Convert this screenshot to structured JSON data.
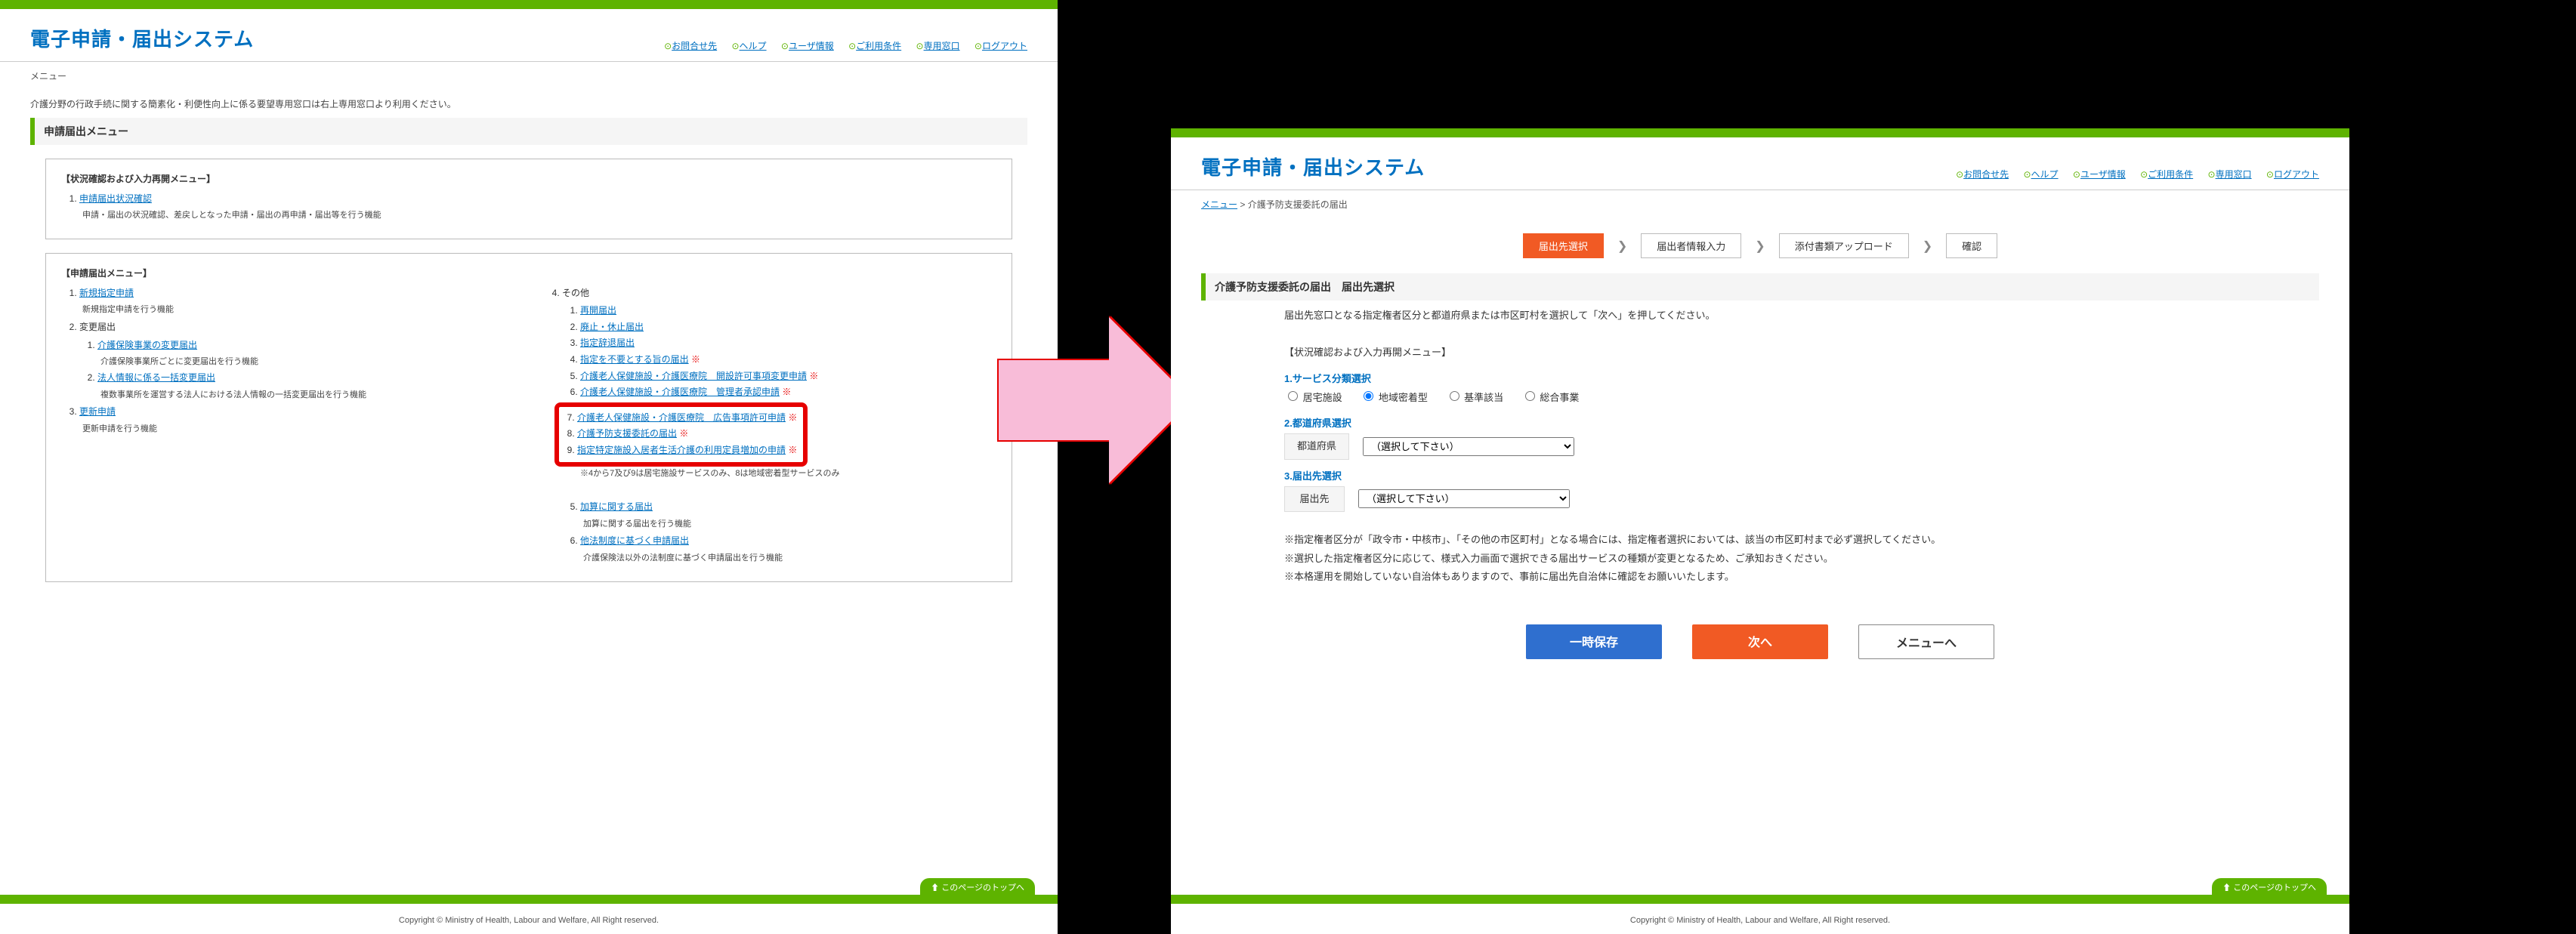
{
  "left": {
    "app_title": "電子申請・届出システム",
    "header_links": [
      "お問合せ先",
      "ヘルプ",
      "ユーザ情報",
      "ご利用条件",
      "専用窓口",
      "ログアウト"
    ],
    "breadcrumb": "メニュー",
    "notice": "介護分野の行政手続に関する簡素化・利便性向上に係る要望専用窓口は右上専用窓口より利用ください。",
    "section_title": "申請届出メニュー",
    "status_box": {
      "heading": "【状況確認および入力再開メニュー】",
      "link": "申請届出状況確認",
      "desc": "申請・届出の状況確認、差戻しとなった申請・届出の再申請・届出等を行う機能"
    },
    "menu_box": {
      "heading": "【申請届出メニュー】",
      "col_left": {
        "item1": {
          "link": "新規指定申請",
          "desc": "新規指定申請を行う機能"
        },
        "item2": {
          "label": "変更届出",
          "sub1": {
            "link": "介護保険事業の変更届出",
            "desc": "介護保険事業所ごとに変更届出を行う機能"
          },
          "sub2": {
            "link": "法人情報に係る一括変更届出",
            "desc": "複数事業所を運営する法人における法人情報の一括変更届出を行う機能"
          }
        },
        "item3": {
          "link": "更新申請",
          "desc": "更新申請を行う機能"
        }
      },
      "col_right": {
        "label": "その他",
        "sub1": "再開届出",
        "sub2": "廃止・休止届出",
        "sub3": "指定辞退届出",
        "sub4": {
          "link": "指定を不要とする旨の届出",
          "note": "※"
        },
        "sub5": {
          "link": "介護老人保健施設・介護医療院　開設許可事項変更申請",
          "note": "※"
        },
        "sub6": {
          "link": "介護老人保健施設・介護医療院　管理者承認申請",
          "note": "※"
        },
        "sub7": {
          "link": "介護老人保健施設・介護医療院　広告事項許可申請",
          "note": "※"
        },
        "sub8": {
          "link": "介護予防支援委託の届出",
          "note": "※"
        },
        "sub9": {
          "link": "指定特定施設入居者生活介護の利用定員増加の申請",
          "note": "※"
        },
        "sub_desc": "※4から7及び9は居宅施設サービスのみ、8は地域密着型サービスのみ",
        "sub10": {
          "link": "加算に関する届出",
          "desc": "加算に関する届出を行う機能"
        },
        "sub11": {
          "link": "他法制度に基づく申請届出",
          "desc": "介護保険法以外の法制度に基づく申請届出を行う機能"
        }
      }
    },
    "backtop": "このページのトップへ",
    "copyright": "Copyright © Ministry of Health, Labour and Welfare, All Right reserved."
  },
  "right": {
    "app_title": "電子申請・届出システム",
    "header_links": [
      "お問合せ先",
      "ヘルプ",
      "ユーザ情報",
      "ご利用条件",
      "専用窓口",
      "ログアウト"
    ],
    "breadcrumb_link": "メニュー",
    "breadcrumb_tail": "  >  介護予防支援委託の届出",
    "steps": [
      "届出先選択",
      "届出者情報入力",
      "添付書類アップロード",
      "確認"
    ],
    "section_title": "介護予防支援委託の届出　届出先選択",
    "lead": "届出先窓口となる指定権者区分と都道府県または市区町村を選択して「次へ」を押してください。",
    "status_heading": "【状況確認および入力再開メニュー】",
    "q1_label": "1.サービス分類選択",
    "radios": [
      "居宅施設",
      "地域密着型",
      "基準該当",
      "総合事業"
    ],
    "radio_selected": 1,
    "q2_label": "2.都道府県選択",
    "q2_field": "都道府県",
    "q2_placeholder": "（選択して下さい）",
    "q3_label": "3.届出先選択",
    "q3_field": "届出先",
    "q3_placeholder": "（選択して下さい）",
    "notes": [
      "※指定権者区分が「政令市・中核市」、「その他の市区町村」となる場合には、指定権者選択においては、該当の市区町村まで必ず選択してください。",
      "※選択した指定権者区分に応じて、様式入力画面で選択できる届出サービスの種類が変更となるため、ご承知おきください。",
      "※本格運用を開始していない自治体もありますので、事前に届出先自治体に確認をお願いいたします。"
    ],
    "btn_save": "一時保存",
    "btn_next": "次へ",
    "btn_menu": "メニューへ",
    "backtop": "このページのトップへ",
    "copyright": "Copyright © Ministry of Health, Labour and Welfare, All Right reserved."
  }
}
